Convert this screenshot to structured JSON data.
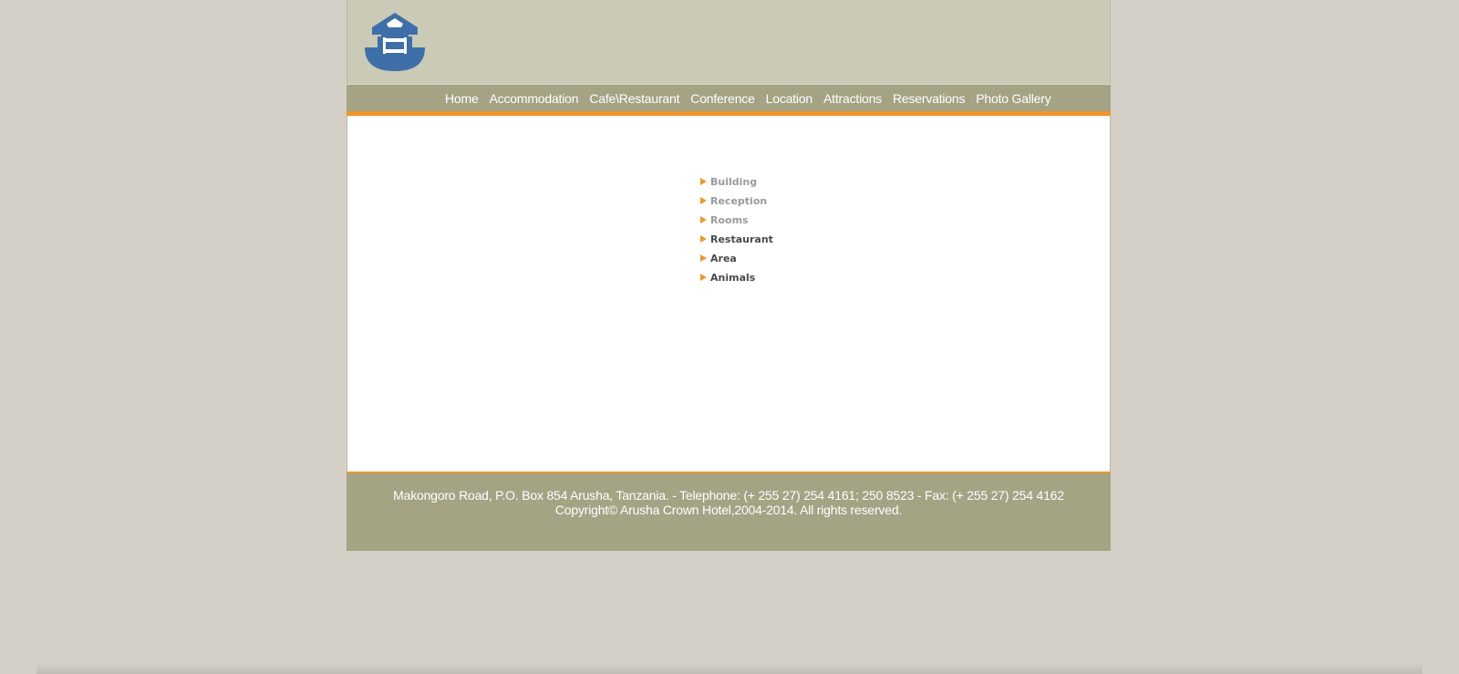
{
  "logo": {
    "icon": "hotel-logo-icon",
    "color": "#3f6fa8"
  },
  "nav": {
    "items": [
      {
        "label": "Home"
      },
      {
        "label": "Accommodation"
      },
      {
        "label": "Cafe\\Restaurant"
      },
      {
        "label": "Conference"
      },
      {
        "label": "Location"
      },
      {
        "label": "Attractions"
      },
      {
        "label": "Reservations"
      },
      {
        "label": "Photo Gallery"
      }
    ]
  },
  "submenu": {
    "items": [
      {
        "label": "Building",
        "style": "light"
      },
      {
        "label": "Reception",
        "style": "light"
      },
      {
        "label": "Rooms",
        "style": "light"
      },
      {
        "label": "Restaurant",
        "style": "dark"
      },
      {
        "label": "Area",
        "style": "dark"
      },
      {
        "label": "Animals",
        "style": "dark"
      }
    ]
  },
  "footer": {
    "address": "Makongoro Road, P.O. Box 854 Arusha, Tanzania. - Telephone: (+ 255 27) 254 4161; 250 8523 - Fax: (+ 255 27) 254 4162",
    "copyright": "Copyright© Arusha Crown Hotel,2004-2014. All rights reserved."
  },
  "colors": {
    "accent": "#f0962b",
    "nav_bg": "#a4a384",
    "header_bg": "#cacab7",
    "page_bg": "#d4d0c8"
  }
}
